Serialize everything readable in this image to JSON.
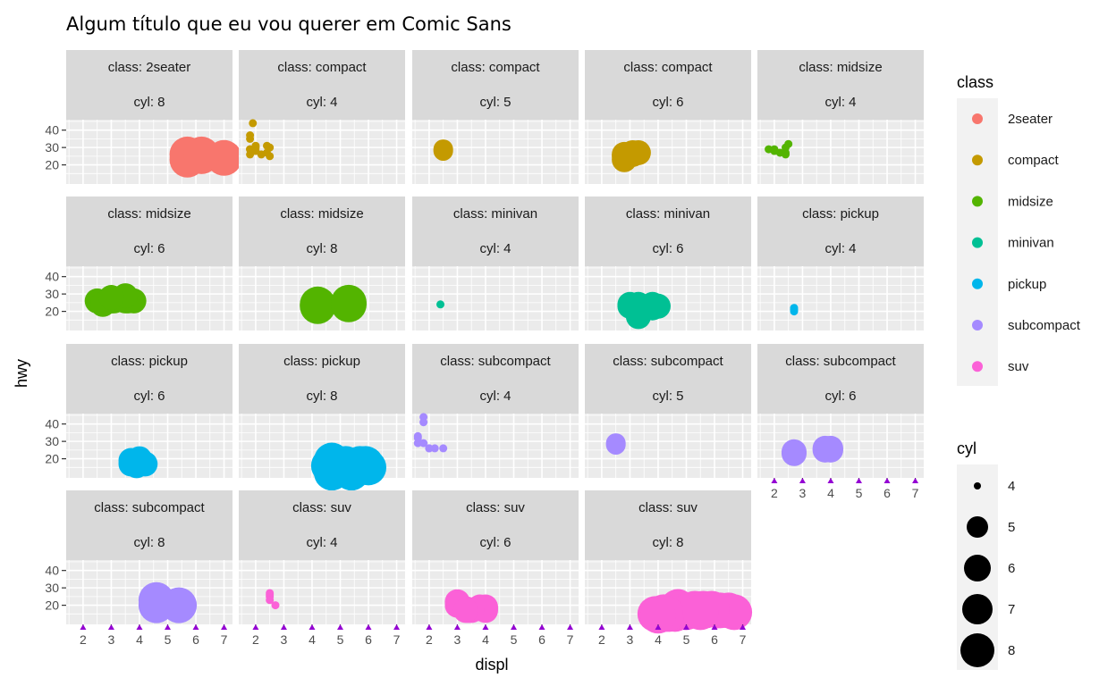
{
  "chart_data": {
    "type": "scatter",
    "title": "Algum título que eu vou querer em Comic Sans",
    "xlabel": "displ",
    "ylabel": "hwy",
    "xlim": [
      1.4,
      7.3
    ],
    "ylim": [
      9,
      46
    ],
    "x_ticks": [
      2,
      3,
      4,
      5,
      6,
      7
    ],
    "y_ticks": [
      20,
      30,
      40
    ],
    "grid": true,
    "facet_label_template": [
      "class: ",
      "cyl: "
    ],
    "legend_position": "right",
    "color_legend": {
      "title": "class",
      "entries": [
        {
          "name": "2seater",
          "color": "#F8766D"
        },
        {
          "name": "compact",
          "color": "#C49A00"
        },
        {
          "name": "midsize",
          "color": "#53B400"
        },
        {
          "name": "minivan",
          "color": "#00C094"
        },
        {
          "name": "pickup",
          "color": "#00B6EB"
        },
        {
          "name": "subcompact",
          "color": "#A58AFF"
        },
        {
          "name": "suv",
          "color": "#FB61D7"
        }
      ]
    },
    "size_legend": {
      "title": "cyl",
      "entries": [
        4,
        5,
        6,
        7,
        8
      ]
    },
    "panels": [
      {
        "class": "2seater",
        "cyl": 8,
        "color": "#F8766D",
        "points": [
          [
            5.7,
            26
          ],
          [
            6.2,
            25
          ],
          [
            7.0,
            24
          ],
          [
            5.7,
            23
          ],
          [
            6.2,
            26
          ]
        ]
      },
      {
        "class": "compact",
        "cyl": 4,
        "color": "#C49A00",
        "points": [
          [
            1.8,
            29
          ],
          [
            1.8,
            29
          ],
          [
            2.0,
            31
          ],
          [
            2.0,
            30
          ],
          [
            1.8,
            26
          ],
          [
            2.2,
            26
          ],
          [
            2.4,
            27
          ],
          [
            2.5,
            25
          ],
          [
            1.8,
            35
          ],
          [
            1.8,
            37
          ],
          [
            1.9,
            44
          ],
          [
            2.4,
            31
          ],
          [
            2.0,
            28
          ],
          [
            2.5,
            30
          ]
        ]
      },
      {
        "class": "compact",
        "cyl": 5,
        "color": "#C49A00",
        "points": [
          [
            2.5,
            29
          ],
          [
            2.5,
            28
          ]
        ]
      },
      {
        "class": "compact",
        "cyl": 6,
        "color": "#C49A00",
        "points": [
          [
            2.8,
            26
          ],
          [
            3.1,
            27
          ],
          [
            2.8,
            23
          ],
          [
            3.3,
            27
          ],
          [
            2.8,
            25
          ],
          [
            3.1,
            26
          ]
        ]
      },
      {
        "class": "midsize",
        "cyl": 4,
        "color": "#53B400",
        "points": [
          [
            1.8,
            29
          ],
          [
            2.0,
            29
          ],
          [
            2.4,
            27
          ],
          [
            2.5,
            32
          ],
          [
            2.4,
            30
          ],
          [
            2.2,
            27
          ],
          [
            2.4,
            26
          ],
          [
            2.0,
            28
          ]
        ]
      },
      {
        "class": "midsize",
        "cyl": 6,
        "color": "#53B400",
        "points": [
          [
            2.5,
            26
          ],
          [
            2.8,
            25
          ],
          [
            3.0,
            26
          ],
          [
            3.1,
            26
          ],
          [
            3.3,
            27
          ],
          [
            3.5,
            26
          ],
          [
            3.6,
            26
          ],
          [
            3.8,
            26
          ],
          [
            3.5,
            29
          ],
          [
            2.7,
            24
          ],
          [
            3.0,
            28
          ]
        ]
      },
      {
        "class": "midsize",
        "cyl": 8,
        "color": "#53B400",
        "points": [
          [
            4.2,
            23
          ],
          [
            5.3,
            25
          ],
          [
            4.2,
            24
          ],
          [
            5.3,
            24
          ]
        ]
      },
      {
        "class": "minivan",
        "cyl": 4,
        "color": "#00C094",
        "points": [
          [
            2.4,
            24
          ]
        ]
      },
      {
        "class": "minivan",
        "cyl": 6,
        "color": "#00C094",
        "points": [
          [
            3.0,
            24
          ],
          [
            3.3,
            22
          ],
          [
            3.8,
            22
          ],
          [
            3.8,
            24
          ],
          [
            4.0,
            23
          ],
          [
            3.3,
            17
          ],
          [
            3.8,
            23
          ],
          [
            3.3,
            24
          ],
          [
            3.0,
            23
          ]
        ]
      },
      {
        "class": "pickup",
        "cyl": 4,
        "color": "#00B6EB",
        "points": [
          [
            2.7,
            20
          ],
          [
            2.7,
            22
          ],
          [
            2.7,
            21
          ]
        ]
      },
      {
        "class": "pickup",
        "cyl": 6,
        "color": "#00B6EB",
        "points": [
          [
            3.7,
            17
          ],
          [
            3.9,
            17
          ],
          [
            4.0,
            18
          ],
          [
            4.2,
            17
          ],
          [
            3.7,
            19
          ],
          [
            4.0,
            20
          ],
          [
            3.9,
            16
          ]
        ]
      },
      {
        "class": "pickup",
        "cyl": 8,
        "color": "#00B6EB",
        "points": [
          [
            4.7,
            17
          ],
          [
            5.2,
            15
          ],
          [
            5.7,
            17
          ],
          [
            5.9,
            17
          ],
          [
            4.7,
            12
          ],
          [
            5.2,
            17
          ],
          [
            5.4,
            16
          ],
          [
            4.6,
            16
          ],
          [
            5.4,
            12
          ],
          [
            4.7,
            19
          ],
          [
            5.7,
            15
          ],
          [
            6.0,
            15
          ],
          [
            5.2,
            16
          ]
        ]
      },
      {
        "class": "subcompact",
        "cyl": 4,
        "color": "#A58AFF",
        "points": [
          [
            1.6,
            33
          ],
          [
            1.6,
            32
          ],
          [
            1.8,
            29
          ],
          [
            2.0,
            26
          ],
          [
            2.5,
            26
          ],
          [
            1.8,
            44
          ],
          [
            1.8,
            41
          ],
          [
            2.0,
            26
          ],
          [
            1.6,
            29
          ],
          [
            2.2,
            26
          ]
        ]
      },
      {
        "class": "subcompact",
        "cyl": 5,
        "color": "#A58AFF",
        "points": [
          [
            2.5,
            29
          ],
          [
            2.5,
            28
          ]
        ]
      },
      {
        "class": "subcompact",
        "cyl": 6,
        "color": "#A58AFF",
        "points": [
          [
            2.7,
            24
          ],
          [
            3.8,
            26
          ],
          [
            4.0,
            25
          ],
          [
            4.0,
            26
          ],
          [
            2.7,
            23
          ],
          [
            3.8,
            25
          ]
        ]
      },
      {
        "class": "subcompact",
        "cyl": 8,
        "color": "#A58AFF",
        "points": [
          [
            4.6,
            23
          ],
          [
            5.4,
            20
          ],
          [
            4.6,
            20
          ]
        ]
      },
      {
        "class": "suv",
        "cyl": 4,
        "color": "#FB61D7",
        "points": [
          [
            2.5,
            27
          ],
          [
            2.5,
            25
          ],
          [
            2.7,
            20
          ],
          [
            2.5,
            26
          ],
          [
            2.5,
            23
          ]
        ]
      },
      {
        "class": "suv",
        "cyl": 6,
        "color": "#FB61D7",
        "points": [
          [
            3.0,
            22
          ],
          [
            4.0,
            17
          ],
          [
            3.7,
            18
          ],
          [
            3.3,
            18
          ],
          [
            4.0,
            19
          ],
          [
            3.4,
            17
          ],
          [
            3.0,
            20
          ],
          [
            3.8,
            19
          ],
          [
            4.0,
            18
          ],
          [
            3.5,
            17
          ],
          [
            3.3,
            17
          ]
        ]
      },
      {
        "class": "suv",
        "cyl": 8,
        "color": "#FB61D7",
        "points": [
          [
            4.2,
            16
          ],
          [
            4.4,
            15
          ],
          [
            4.7,
            17
          ],
          [
            5.3,
            18
          ],
          [
            5.7,
            17
          ],
          [
            6.1,
            17
          ],
          [
            4.7,
            19
          ],
          [
            6.5,
            17
          ],
          [
            4.6,
            15
          ],
          [
            5.4,
            17
          ],
          [
            3.9,
            15
          ],
          [
            4.7,
            16
          ],
          [
            5.0,
            16
          ],
          [
            5.6,
            18
          ],
          [
            6.2,
            17
          ],
          [
            4.3,
            15
          ],
          [
            6.7,
            16
          ],
          [
            5.9,
            18
          ],
          [
            5.5,
            16
          ],
          [
            4.0,
            14
          ]
        ]
      }
    ]
  }
}
